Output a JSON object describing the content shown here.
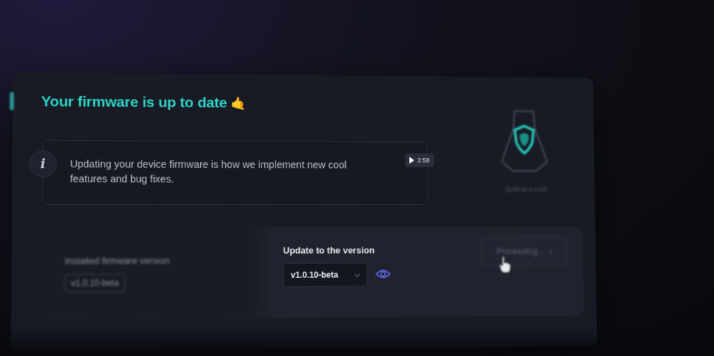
{
  "header": {
    "title": "Your firmware is up to date",
    "title_emoji": "🤙"
  },
  "info": {
    "icon": "info-icon",
    "text": "Updating your device firmware is how we implement new cool features and bug fixes.",
    "video_duration": "2:58"
  },
  "device": {
    "icon": "shield-device-icon",
    "caption": "[Sold as a rock]"
  },
  "installed": {
    "label": "Installed firmware version",
    "version": "v1.0.10-beta"
  },
  "update": {
    "label": "Update to the version",
    "selected_version": "v1.0.10-beta",
    "proceed_label": "Proceeding..."
  },
  "colors": {
    "accent": "#2ed3c6",
    "eye_icon": "#5b5fe0",
    "background": "#181a24"
  }
}
